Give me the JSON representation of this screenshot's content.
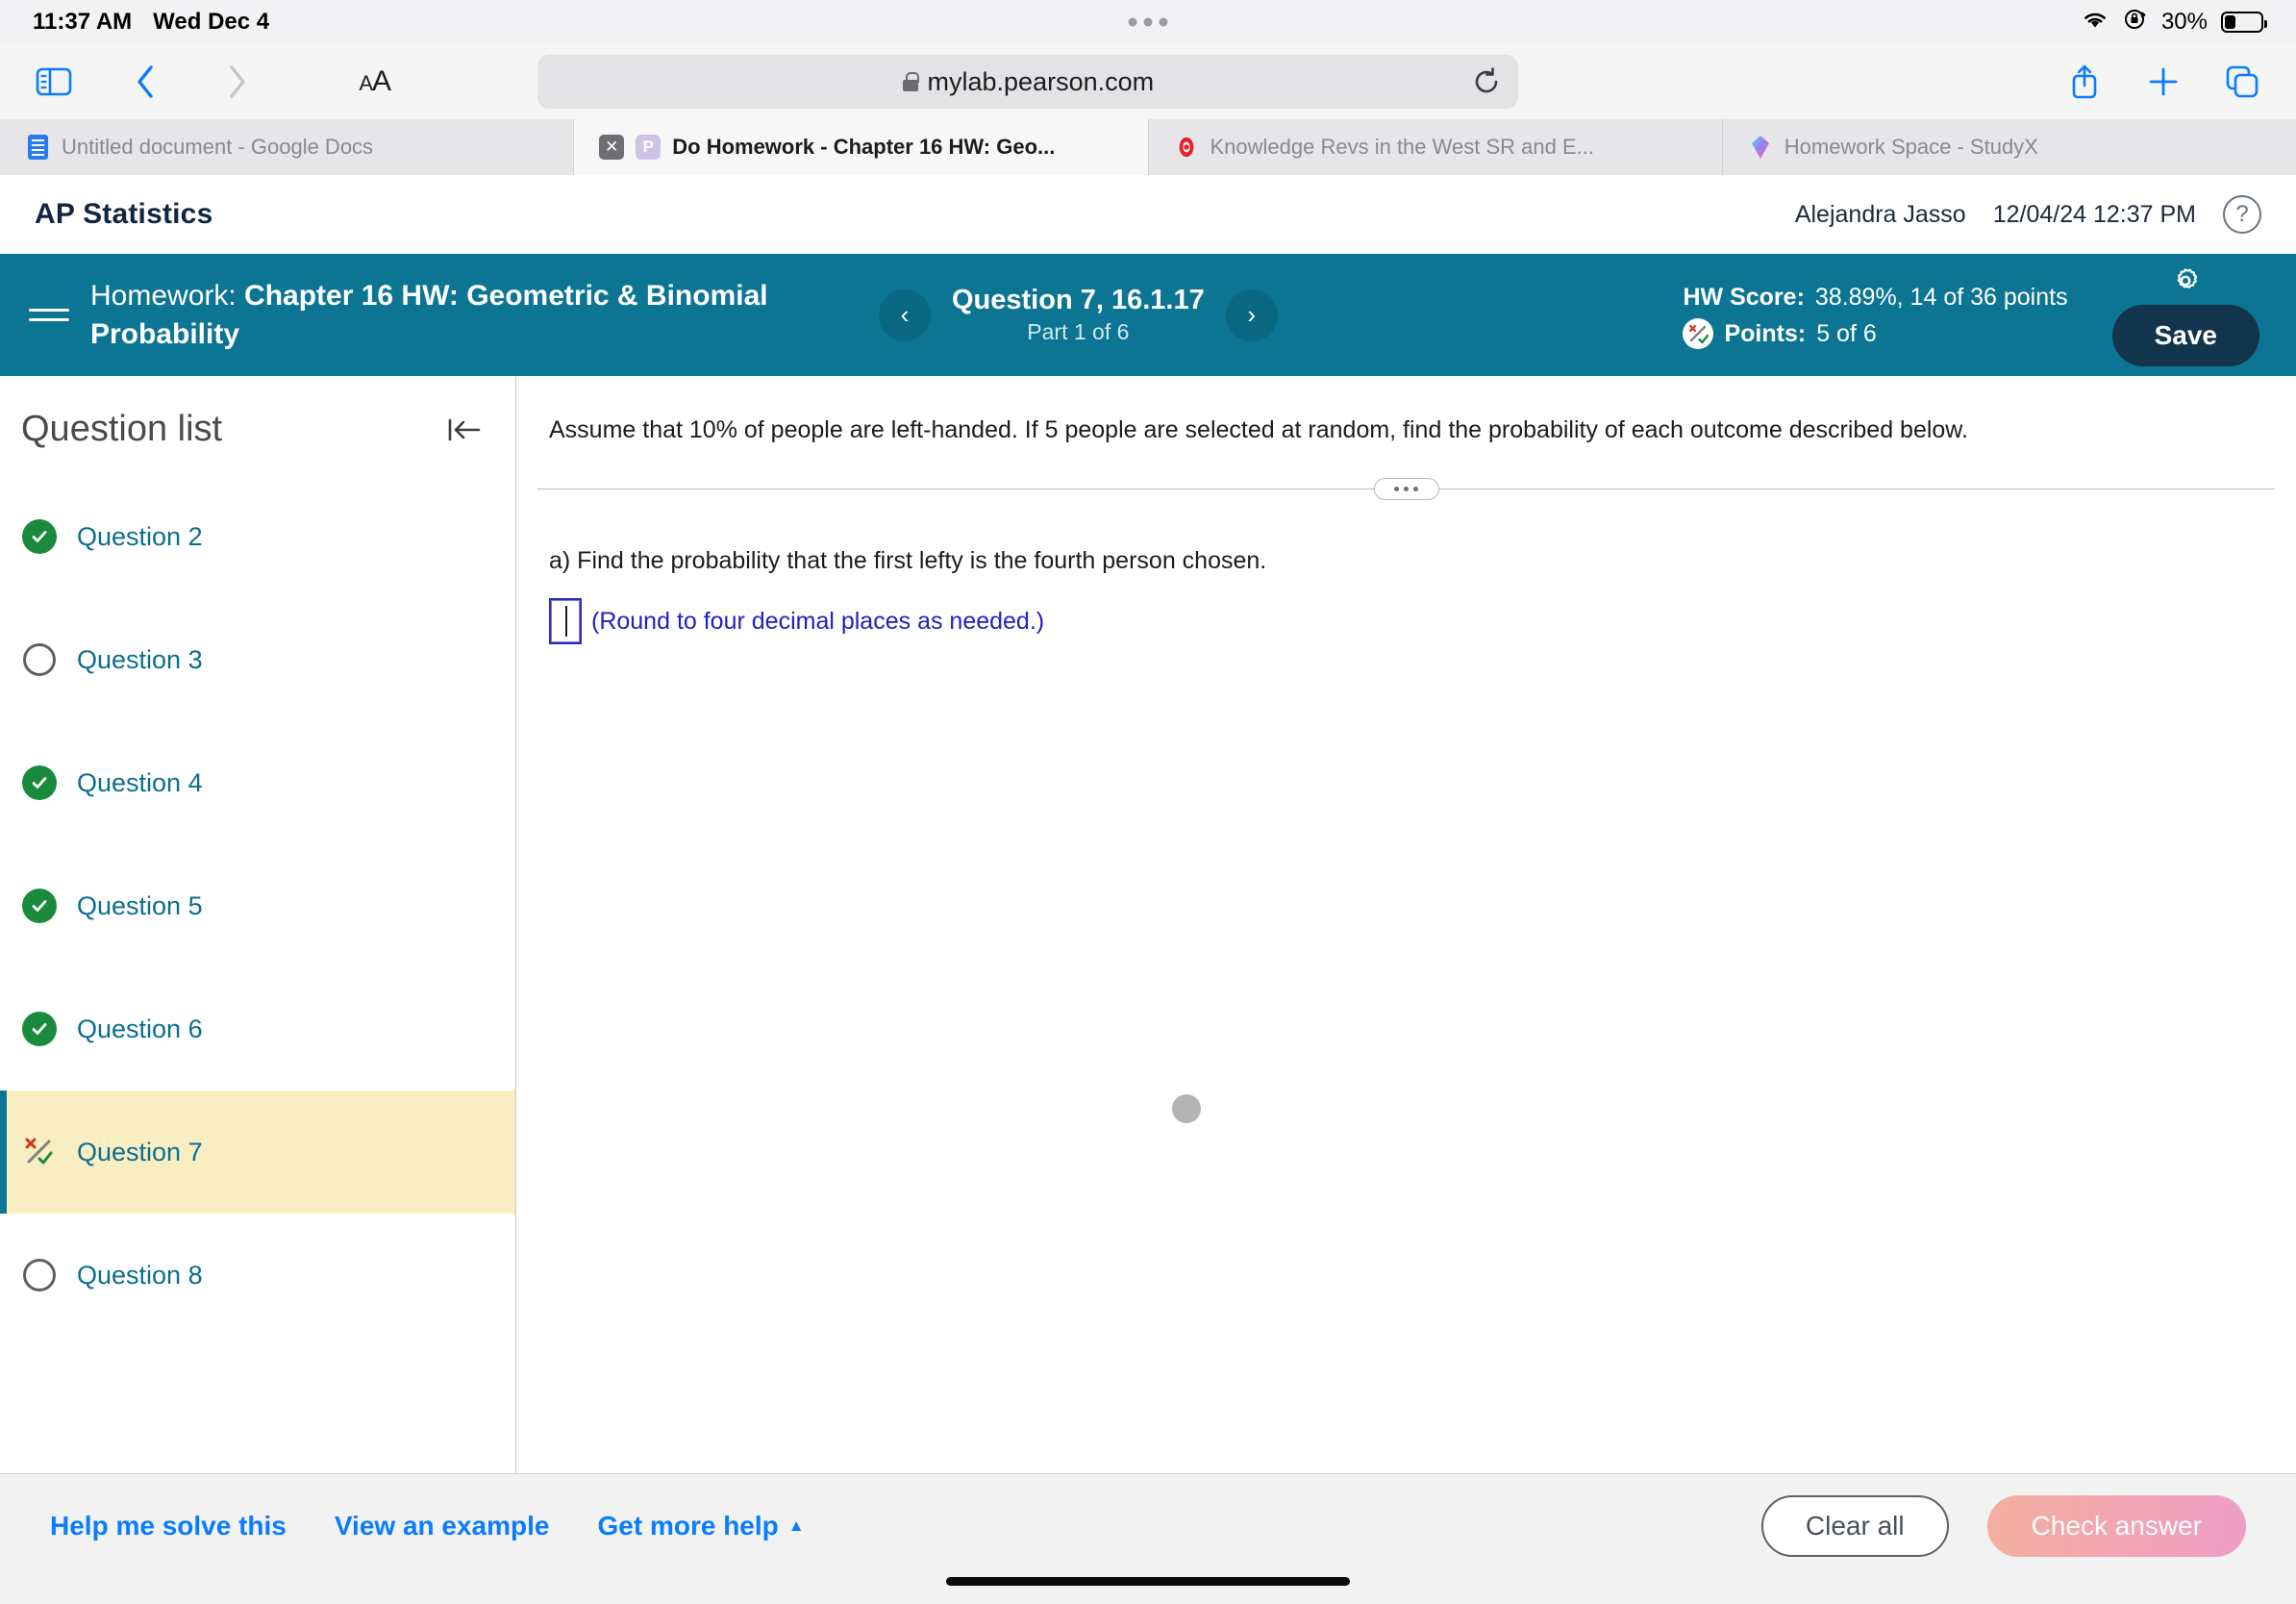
{
  "status_bar": {
    "time": "11:37 AM",
    "date": "Wed Dec 4",
    "battery_percent": "30%",
    "wifi_icon": "wifi-icon",
    "rotation_lock_icon": "rotation-lock-icon",
    "battery_icon": "battery-icon"
  },
  "browser": {
    "sidebar_icon": "sidebar-toggle-icon",
    "back_icon": "back-chevron-icon",
    "forward_icon": "forward-chevron-icon",
    "text_size_label": "AA",
    "url": "mylab.pearson.com",
    "lock_icon": "lock-icon",
    "reload_icon": "reload-icon",
    "share_icon": "share-icon",
    "new_tab_icon": "plus-icon",
    "tabs_overview_icon": "tabs-overview-icon",
    "tabs": [
      {
        "title": "Untitled document - Google Docs",
        "favicon": "google-docs-icon",
        "active": false
      },
      {
        "title": "Do Homework - Chapter 16 HW: Geo...",
        "favicon": "pearson-p-icon",
        "active": true,
        "close_label": "✕"
      },
      {
        "title": "Knowledge Revs in the West SR and E...",
        "favicon": "quizlet-icon",
        "active": false
      },
      {
        "title": "Homework Space - StudyX",
        "favicon": "studyx-icon",
        "active": false
      }
    ]
  },
  "page_header": {
    "course": "AP Statistics",
    "user": "Alejandra Jasso",
    "datetime": "12/04/24 12:37 PM",
    "help_icon": "question-mark-icon",
    "help_label": "?"
  },
  "banner": {
    "menu_icon": "hamburger-menu-icon",
    "homework_prefix": "Homework:",
    "homework_name": "Chapter 16 HW: Geometric & Binomial Probability",
    "prev_icon": "prev-question-icon",
    "prev_label": "‹",
    "next_icon": "next-question-icon",
    "next_label": "›",
    "question_title": "Question 7, 16.1.17",
    "question_part": "Part 1 of 6",
    "hw_score_label": "HW Score:",
    "hw_score_value": "38.89%, 14 of 36 points",
    "points_label": "Points:",
    "points_value": "5 of 6",
    "partial_credit_icon": "partial-credit-icon",
    "settings_icon": "gear-icon",
    "save_label": "Save",
    "accent_color": "#0b7593",
    "save_color": "#13344d"
  },
  "question_list": {
    "title": "Question list",
    "collapse_icon": "collapse-panel-icon",
    "items": [
      {
        "label": "Question 2",
        "status": "correct",
        "status_icon": "green-check-icon",
        "active": false
      },
      {
        "label": "Question 3",
        "status": "unanswered",
        "status_icon": "empty-circle-icon",
        "active": false
      },
      {
        "label": "Question 4",
        "status": "correct",
        "status_icon": "green-check-icon",
        "active": false
      },
      {
        "label": "Question 5",
        "status": "correct",
        "status_icon": "green-check-icon",
        "active": false
      },
      {
        "label": "Question 6",
        "status": "correct",
        "status_icon": "green-check-icon",
        "active": false
      },
      {
        "label": "Question 7",
        "status": "partial",
        "status_icon": "partial-credit-icon",
        "active": true
      },
      {
        "label": "Question 8",
        "status": "unanswered",
        "status_icon": "empty-circle-icon",
        "active": false
      }
    ],
    "highlight_color": "#f8eec2",
    "link_color": "#0b6e8f"
  },
  "question": {
    "prompt": "Assume that 10% of people are left-handed. If 5 people are selected at random, find the probability of each outcome described below.",
    "divider_handle_icon": "drag-handle-dots-icon",
    "part_text": "a) Find the probability that the first lefty is the fourth person chosen.",
    "answer_value": "",
    "answer_hint": "(Round to four decimal places as needed.)",
    "touch_indicator_icon": "touch-point-indicator"
  },
  "bottom_bar": {
    "help_me_solve": "Help me solve this",
    "view_example": "View an example",
    "get_more_help": "Get more help",
    "get_more_help_caret": "▲",
    "clear_all": "Clear all",
    "check_answer": "Check answer"
  }
}
